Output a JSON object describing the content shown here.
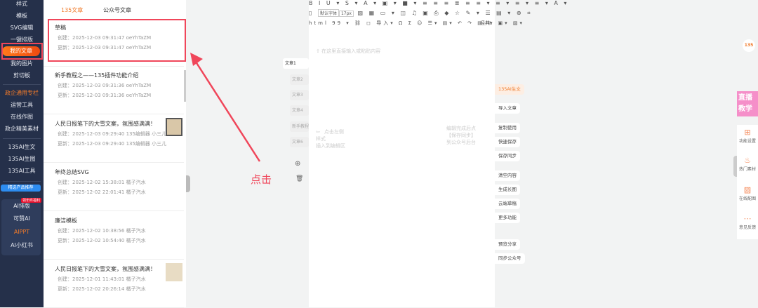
{
  "sidebar": {
    "items": [
      "样式",
      "模板",
      "SVG编辑",
      "一键排版",
      "我的文章",
      "我的图片",
      "剪切板"
    ],
    "section2": [
      "政企通用专栏",
      "运营工具",
      "在线作图",
      "政企精美素材"
    ],
    "ai": [
      "135AI生文",
      "135AI生图",
      "135AI工具"
    ],
    "promo_badge": "精选产品推荐",
    "promo_tag": "领年终福利",
    "sub": [
      "AI排版",
      "可赞AI",
      "AIPPT",
      "AI小红书"
    ]
  },
  "list": {
    "tabs": [
      "135文章",
      "公众号文章"
    ],
    "articles": [
      {
        "title": "草稿",
        "created": "创建：2025-12-03 09:31:47  oeYhTaZM",
        "updated": "更新：2025-12-03 09:31:47  oeYhTaZM"
      },
      {
        "title": "新手教程之——135插件功能介绍",
        "created": "创建：2025-12-03 09:31:36  oeYhTaZM",
        "updated": "更新：2025-12-03 09:31:36  oeYhTaZM"
      },
      {
        "title": "人民日报笔下的大雪文案，氛围感满满！",
        "created": "创建：2025-12-03 09:29:40  135编辑器 小三儿",
        "updated": "更新：2025-12-03 09:29:40  135编辑器 小三儿"
      },
      {
        "title": "年终总结SVG",
        "created": "创建：2025-12-02 15:38:01  橘子汽水",
        "updated": "更新：2025-12-02 22:01:41  橘子汽水"
      },
      {
        "title": "廉洁模板",
        "created": "创建：2025-12-02 10:38:56  橘子汽水",
        "updated": "更新：2025-12-02 10:54:40  橘子汽水"
      },
      {
        "title": "人民日报笔下的大雪文案，氛围感满满！",
        "created": "创建：2025-12-01 11:43:01  橘子汽水",
        "updated": "更新：2025-12-02 20:26:14  橘子汽水"
      }
    ]
  },
  "annotation": {
    "label": "点击"
  },
  "article_tabs": [
    "文章1",
    "文章2",
    "文章3",
    "文章4",
    "新手教程",
    "文章6"
  ],
  "editor": {
    "toolbar_row1": "B I U ▾ S ▾ A ▾ ▣ ▾ ■ ▾ ≡ ≡ ≡ ≣ ≡ ≡ ▾ ≡ ▾ ≡ ▾ ≡ ▾ A ▾",
    "font": "默认字体",
    "size": "17px",
    "toolbar_row2": "▨ ▦ ▭ ▾ ◫ ♫ ▣ ⎙ ◆ ☆ ✎ ▾ ☰ ▤ ▾ ⊕ ⌗",
    "toolbar_row3": "html 99 ▾ ⛓ ◻ 导入▾ Ω Σ ☺ ☰▾ ▤▾ ↶ ↷ ▤ ⚠ ▣▾ ▨▾",
    "classic": "经典▾",
    "placeholder": "在这里直接输入或粘贴内容",
    "hint_left": [
      "点击左侧样式",
      "插入到编辑区"
    ],
    "hint_right": [
      "编辑完成后点",
      "【保存同步】",
      "到公众号后台"
    ]
  },
  "right_buttons": {
    "ai": "135AI生文",
    "items": [
      "导入文章",
      "复制使用",
      "快速保存",
      "保存同步",
      "清空内容",
      "生成长图",
      "云端草稿",
      "更多功能",
      "预览分享",
      "同步公众号"
    ]
  },
  "right_sidebar": {
    "logo": "135",
    "banner": "直播教学",
    "items": [
      {
        "icon": "grid-icon",
        "label": "功能设置"
      },
      {
        "icon": "fire-icon",
        "label": "热门素材"
      },
      {
        "icon": "image-icon",
        "label": "在线配图"
      },
      {
        "icon": "chat-icon",
        "label": "意见反馈"
      }
    ]
  },
  "colors": {
    "accent": "#f07a2a",
    "highlight": "#f0465a",
    "sidebar": "#25304a"
  }
}
